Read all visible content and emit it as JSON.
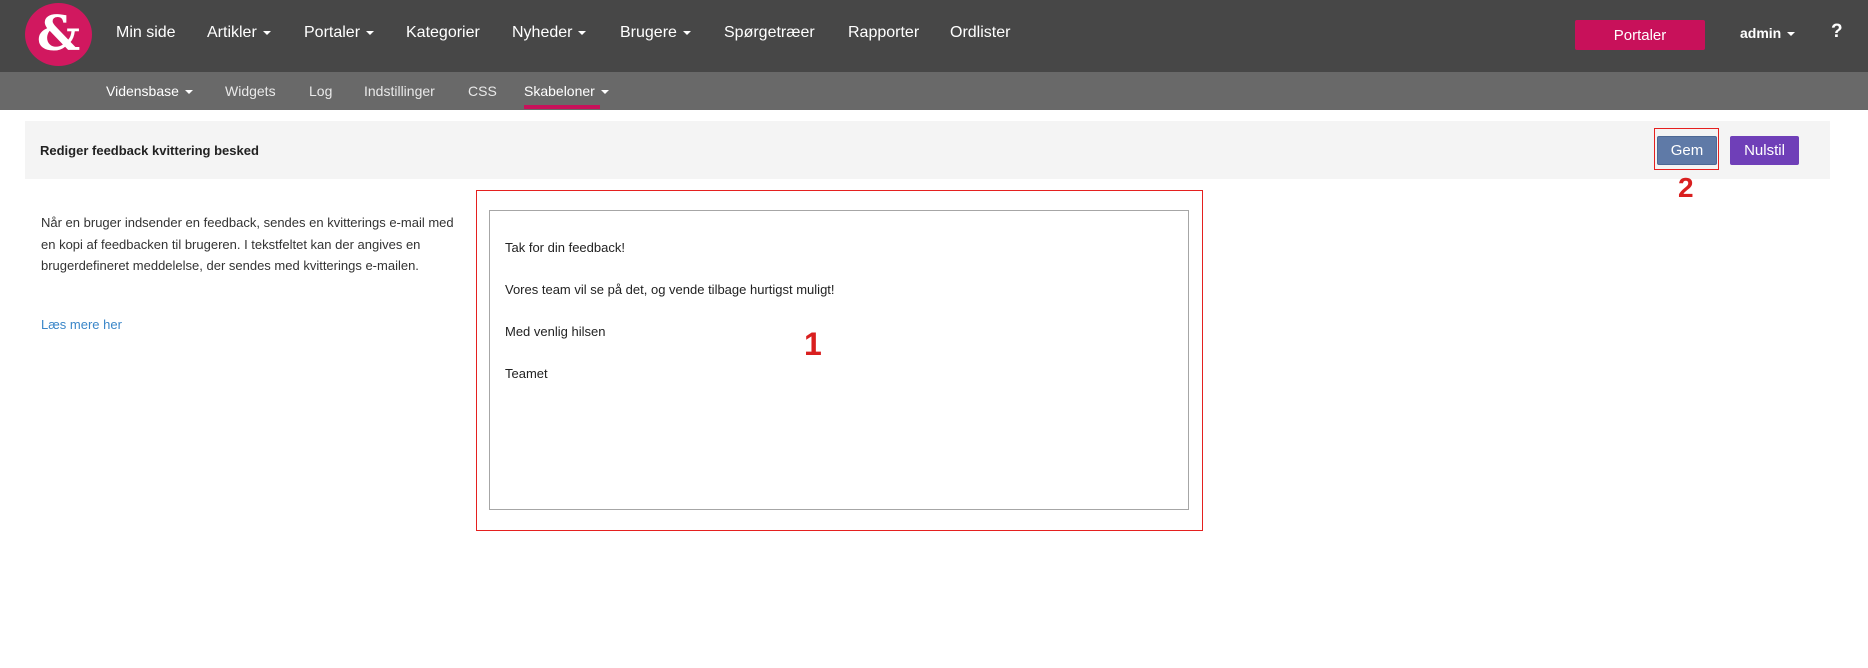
{
  "topnav": {
    "logo_glyph": "&",
    "items": [
      {
        "label": "Min side",
        "dropdown": false
      },
      {
        "label": "Artikler",
        "dropdown": true
      },
      {
        "label": "Portaler",
        "dropdown": true
      },
      {
        "label": "Kategorier",
        "dropdown": false
      },
      {
        "label": "Nyheder",
        "dropdown": true
      },
      {
        "label": "Brugere",
        "dropdown": true
      },
      {
        "label": "Spørgetræer",
        "dropdown": false
      },
      {
        "label": "Rapporter",
        "dropdown": false
      },
      {
        "label": "Ordlister",
        "dropdown": false
      }
    ],
    "portaler_button": "Portaler",
    "user": "admin",
    "help": "?"
  },
  "subnav": {
    "items": [
      {
        "label": "Vidensbase",
        "dropdown": true
      },
      {
        "label": "Widgets",
        "dropdown": false
      },
      {
        "label": "Log",
        "dropdown": false
      },
      {
        "label": "Indstillinger",
        "dropdown": false
      },
      {
        "label": "CSS",
        "dropdown": false
      },
      {
        "label": "Skabeloner",
        "dropdown": true,
        "active": true
      }
    ]
  },
  "header": {
    "title": "Rediger feedback kvittering besked",
    "save_label": "Gem",
    "reset_label": "Nulstil"
  },
  "sidebar": {
    "description": "Når en bruger indsender en feedback, sendes en kvitterings e-mail med en kopi af feedbacken til brugeren. I tekstfeltet kan der angives en brugerdefineret meddelelse, der sendes med kvitterings e-mailen.",
    "link": "Læs mere her"
  },
  "editor": {
    "lines": [
      "Tak for din feedback!",
      "Vores team vil se på det, og vende tilbage hurtigst muligt!",
      "Med venlig hilsen",
      "Teamet"
    ]
  },
  "annotations": {
    "editor_marker": "1",
    "save_marker": "2",
    "marker_color": "#d91f1f"
  },
  "colors": {
    "brand": "#c8115a",
    "topbar": "#474747",
    "subbar": "#696969",
    "save_button": "#5f7aa7",
    "reset_button": "#6f3fb8"
  }
}
